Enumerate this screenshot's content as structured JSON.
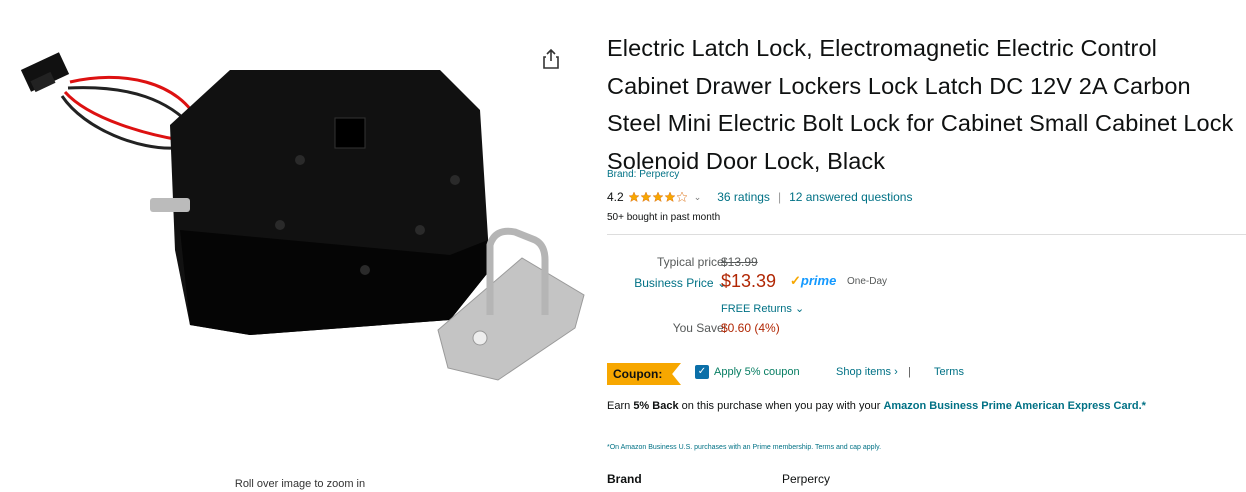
{
  "gallery": {
    "zoom_hint": "Roll over image to zoom in",
    "share_icon": "share-icon"
  },
  "product": {
    "title": "Electric Latch Lock, Electromagnetic Electric Control Cabinet Drawer Lockers Lock Latch DC 12V 2A Carbon Steel Mini Electric Bolt Lock for Cabinet Small Cabinet Lock Solenoid Door Lock, Black",
    "brand_link": "Brand: Perpercy",
    "rating_value": "4.2",
    "rating_stars": 4.2,
    "ratings_count": "36 ratings",
    "separator": "|",
    "answered_questions": "12 answered questions",
    "bought": "50+ bought in past month"
  },
  "pricing": {
    "typical_label": "Typical price:",
    "typical_value": "$13.99",
    "business_label": "Business Price",
    "business_value": "$13.39",
    "prime_check": "✓",
    "prime_word": "prime",
    "one_day": "One-Day",
    "free_returns": "FREE Returns",
    "save_label": "You Save:",
    "save_value": "$0.60 (4%)"
  },
  "coupon": {
    "badge": "Coupon:",
    "apply_text": "Apply 5% coupon",
    "shop_items": "Shop items ›",
    "bar": "|",
    "terms": "Terms"
  },
  "promo": {
    "earn_prefix": "Earn",
    "earn_bold": "5% Back",
    "earn_middle": "on this purchase when you pay with your",
    "earn_card": "Amazon Business Prime American Express Card.*",
    "footnote": "*On Amazon Business U.S. purchases with an Prime membership. Terms and cap apply."
  },
  "specs": {
    "brand_label": "Brand",
    "brand_value": "Perpercy"
  },
  "colors": {
    "link": "#007185",
    "price": "#b12704",
    "coupon": "#f7a700",
    "star": "#f7a700",
    "prime": "#1399ff"
  }
}
